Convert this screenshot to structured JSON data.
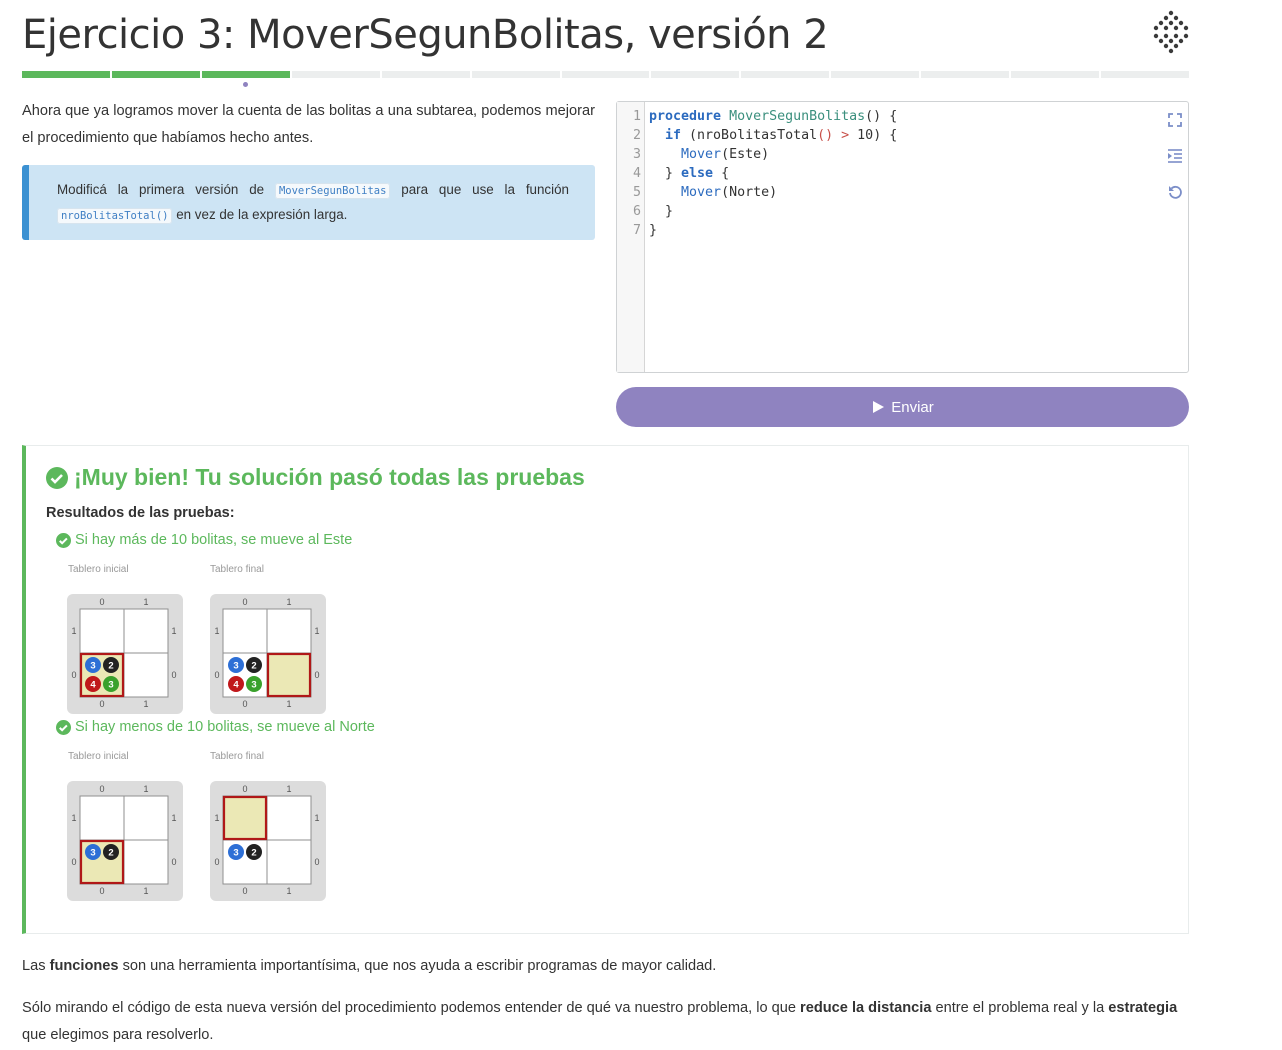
{
  "page": {
    "title": "Ejercicio 3: MoverSegunBolitas, versión 2",
    "progress": {
      "total": 13,
      "completed": 3,
      "current_index": 2
    }
  },
  "intro": {
    "text": "Ahora que ya logramos mover la cuenta de las bolitas a una subtarea, podemos mejorar el procedimiento que habíamos hecho antes."
  },
  "callout": {
    "part1": "Modificá la primera versión de ",
    "code1": "MoverSegunBolitas",
    "part2": " para que use la función ",
    "code2": "nroBolitasTotal()",
    "part3": " en vez de la expresión larga."
  },
  "editor": {
    "line_numbers": [
      "1",
      "2",
      "3",
      "4",
      "5",
      "6",
      "7"
    ],
    "tools": [
      "fullscreen-icon",
      "indent-icon",
      "reset-icon"
    ]
  },
  "submit": {
    "label": "Enviar",
    "icon": "play-icon"
  },
  "results": {
    "title": "¡Muy bien! Tu solución pasó todas las pruebas",
    "subtitle": "Resultados de las pruebas:",
    "tests": [
      {
        "name": "Si hay más de 10 bolitas, se mueve al Este",
        "initial_label": "Tablero inicial",
        "final_label": "Tablero final"
      },
      {
        "name": "Si hay menos de 10 bolitas, se mueve al Norte",
        "initial_label": "Tablero inicial",
        "final_label": "Tablero final"
      }
    ],
    "board_axis": {
      "cols": [
        "0",
        "1"
      ],
      "rows": [
        "1",
        "0"
      ]
    },
    "ball_colors": {
      "azul": "#2d6fd6",
      "negro": "#222222",
      "rojo": "#c0181b",
      "verde": "#3aa12c"
    },
    "boards": {
      "t1_initial": {
        "cursor": "0,0",
        "balls": {
          "azul": "3",
          "negro": "2",
          "rojo": "4",
          "verde": "3"
        }
      },
      "t1_final": {
        "cursor": "1,0",
        "balls": {
          "azul": "3",
          "negro": "2",
          "rojo": "4",
          "verde": "3"
        }
      },
      "t2_initial": {
        "cursor": "0,0",
        "balls": {
          "azul": "3",
          "negro": "2"
        }
      },
      "t2_final": {
        "cursor": "0,1",
        "balls": {
          "azul": "3",
          "negro": "2"
        }
      }
    }
  },
  "footer": {
    "p1_part1": "Las ",
    "p1_bold": "funciones",
    "p1_part2": " son una herramienta importantísima, que nos ayuda a escribir programas de mayor calidad.",
    "p2_part1": "Sólo mirando el código de esta nueva versión del procedimiento podemos entender de qué va nuestro problema, lo que ",
    "p2_bold1": "reduce la distancia",
    "p2_part2": " entre el problema real y la ",
    "p2_bold2": "estrategia",
    "p2_part3": " que elegimos para resolverlo."
  },
  "colors": {
    "accent": "#8f83c0",
    "success": "#5cb85c",
    "info": "#3b91d2",
    "info_bg": "#cde4f4"
  }
}
